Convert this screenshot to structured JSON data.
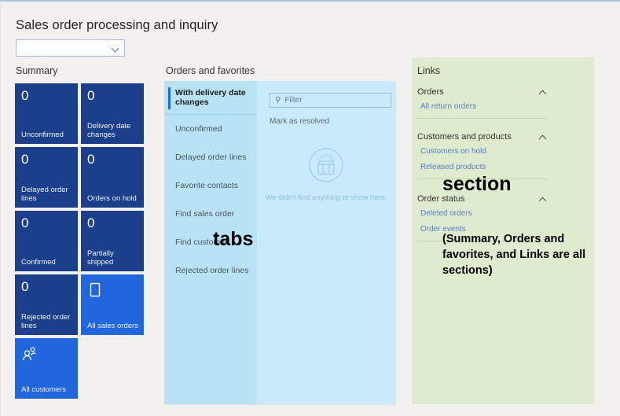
{
  "page": {
    "title": "Sales order processing and inquiry",
    "legal_entity_selector_value": "",
    "legal_entity_selector_icon": "chevron-down-icon"
  },
  "summary": {
    "heading": "Summary",
    "tiles": [
      {
        "value": "0",
        "label": "Unconfirmed",
        "kind": "count"
      },
      {
        "value": "0",
        "label": "Delivery date changes",
        "kind": "count"
      },
      {
        "value": "0",
        "label": "Delayed order lines",
        "kind": "count"
      },
      {
        "value": "0",
        "label": "Orders on hold",
        "kind": "count"
      },
      {
        "value": "0",
        "label": "Confirmed",
        "kind": "count"
      },
      {
        "value": "0",
        "label": "Partially shipped",
        "kind": "count"
      },
      {
        "value": "0",
        "label": "Rejected order lines",
        "kind": "count"
      },
      {
        "value": "",
        "label": "All sales orders",
        "kind": "action",
        "icon": "document-icon"
      },
      {
        "value": "",
        "label": "All customers",
        "kind": "action",
        "icon": "people-icon"
      }
    ]
  },
  "orders_and_favorites": {
    "heading": "Orders and favorites",
    "tabs": [
      {
        "label": "With delivery date changes",
        "active": true
      },
      {
        "label": "Unconfirmed",
        "active": false
      },
      {
        "label": "Delayed order lines",
        "active": false
      },
      {
        "label": "Favorite contacts",
        "active": false
      },
      {
        "label": "Find sales order",
        "active": false
      },
      {
        "label": "Find customer",
        "active": false
      },
      {
        "label": "Rejected order lines",
        "active": false
      }
    ],
    "filter": {
      "placeholder": "Filter",
      "value": "",
      "icon": "search-icon"
    },
    "mark_as_resolved_label": "Mark as resolved",
    "empty_state": {
      "icon": "empty-box-icon",
      "message": "We didn't find anything to show here."
    }
  },
  "links": {
    "heading": "Links",
    "groups": [
      {
        "title": "Orders",
        "collapse_icon": "chevron-up-icon",
        "items": [
          "All return orders"
        ]
      },
      {
        "title": "Customers and products",
        "collapse_icon": "chevron-up-icon",
        "items": [
          "Customers on hold",
          "Released products"
        ]
      },
      {
        "title": "Order status",
        "collapse_icon": "chevron-up-icon",
        "items": [
          "Deleted orders",
          "Order events"
        ]
      }
    ]
  },
  "annotations": {
    "tabs": "tabs",
    "section": "section",
    "note": "(Summary, Orders and favorites, and Links are all sections)"
  },
  "colors": {
    "page_background": "#f2f1f0",
    "tile_count": "#1b3f8b",
    "tile_action": "#2266dd",
    "orders_panel": "#c8eafa",
    "tab_column": "#b8e3f6",
    "links_panel": "#dfebce",
    "link_text": "#5b7fc2",
    "active_tab_marker": "#1f6fd0"
  }
}
